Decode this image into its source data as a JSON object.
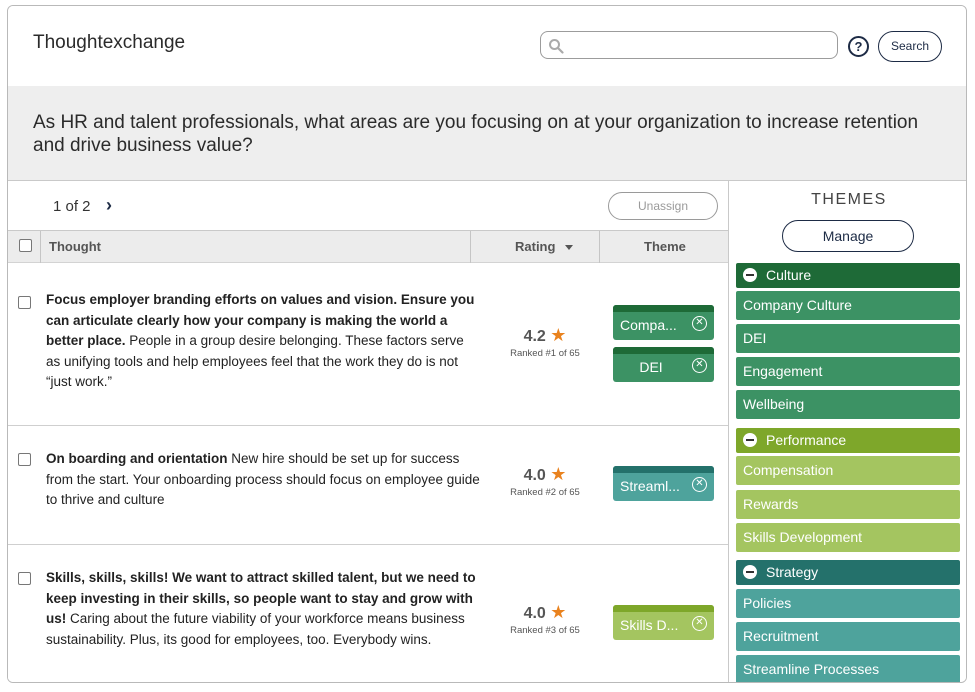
{
  "app": {
    "title": "Thoughtexchange"
  },
  "search": {
    "placeholder": "",
    "button_label": "Search"
  },
  "help": {
    "glyph": "?"
  },
  "question": "As HR and talent professionals, what areas are you focusing on at your organization to increase retention and drive business value?",
  "pager": {
    "text": "1 of 2",
    "next_glyph": "›"
  },
  "toolbar": {
    "unassign_label": "Unassign"
  },
  "table": {
    "headers": {
      "thought": "Thought",
      "rating": "Rating",
      "theme": "Theme"
    },
    "rows": [
      {
        "bold": "Focus employer branding efforts on values and vision. Ensure you can articulate clearly how your company is making the world a better place.",
        "rest": " People in a group desire belonging. These factors serve as unifying tools and help employees feel that the work they do is not “just work.”",
        "rating": "4.2",
        "ranked": "Ranked #1 of 65",
        "tags": [
          {
            "label": "Compa...",
            "color": "#3c9264",
            "top_color": "#1e6a37"
          },
          {
            "label": "DEI",
            "color": "#3c9264",
            "top_color": "#1e6a37"
          }
        ]
      },
      {
        "bold": "On boarding and orientation",
        "rest": " New hire should be set up for success from the start. Your onboarding process should focus on employee guide to thrive and culture",
        "rating": "4.0",
        "ranked": "Ranked #2 of 65",
        "tags": [
          {
            "label": "Streaml...",
            "color": "#4ea39c",
            "top_color": "#24716b"
          }
        ]
      },
      {
        "bold": "Skills, skills, skills! We want to attract skilled talent, but we need to keep investing in their skills, so people want to stay and grow with us!",
        "rest": " Caring about the future viability of your workforce means business sustainability. Plus, its good for employees, too. Everybody wins.",
        "rating": "4.0",
        "ranked": "Ranked #3 of 65",
        "tags": [
          {
            "label": "Skills D...",
            "color": "#a4c560",
            "top_color": "#7ea72a"
          }
        ]
      }
    ]
  },
  "themes": {
    "title": "THEMES",
    "manage_label": "Manage",
    "groups": [
      {
        "name": "Culture",
        "head_color": "#1e6a37",
        "item_color": "#3c9264",
        "items": [
          "Company Culture",
          "DEI",
          "Engagement",
          "Wellbeing"
        ]
      },
      {
        "name": "Performance",
        "head_color": "#7ea72a",
        "item_color": "#a4c560",
        "items": [
          "Compensation",
          "Rewards",
          "Skills Development"
        ]
      },
      {
        "name": "Strategy",
        "head_color": "#24716b",
        "item_color": "#4ea39c",
        "items": [
          "Policies",
          "Recruitment",
          "Streamline Processes"
        ]
      }
    ]
  }
}
